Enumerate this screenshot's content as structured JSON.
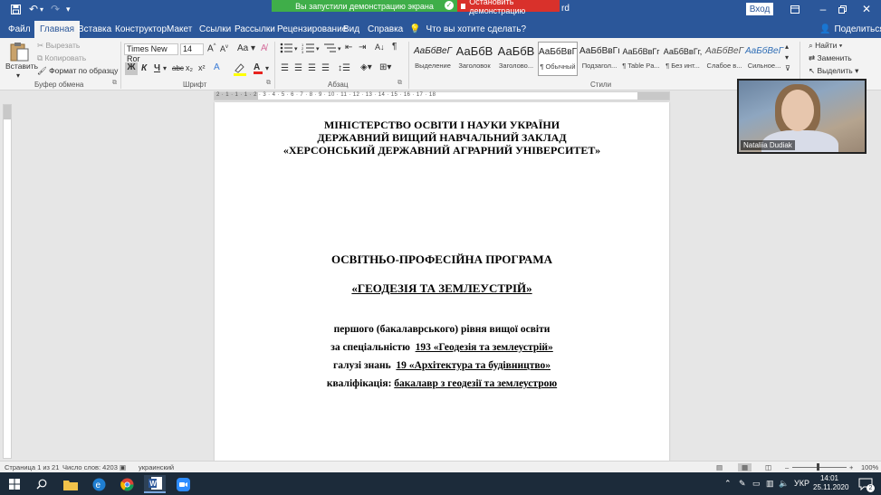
{
  "titlebar": {
    "save_icon": "save-icon",
    "undo_icon": "undo-icon",
    "redo_icon": "redo-icon",
    "customize_icon": "customize-qat-icon",
    "sharing_notice": "Вы запустили демонстрацию экрана",
    "stop_sharing": "Остановить демонстрацию",
    "title_tail": "rd",
    "login": "Вход",
    "ribbon_display_icon": "ribbon-display-icon",
    "minimize_icon": "minimize-icon",
    "restore_icon": "restore-icon",
    "close_icon": "close-icon"
  },
  "tabs": [
    {
      "label": "Файл"
    },
    {
      "label": "Главная",
      "active": true
    },
    {
      "label": "Вставка"
    },
    {
      "label": "Конструктор"
    },
    {
      "label": "Макет"
    },
    {
      "label": "Ссылки"
    },
    {
      "label": "Рассылки"
    },
    {
      "label": "Рецензирование"
    },
    {
      "label": "Вид"
    },
    {
      "label": "Справка"
    }
  ],
  "tell_me": "Что вы хотите сделать?",
  "share": "Поделиться",
  "ribbon": {
    "clipboard": {
      "paste": "Вставить",
      "cut": "Вырезать",
      "copy": "Копировать",
      "format_painter": "Формат по образцу",
      "group": "Буфер обмена"
    },
    "font": {
      "font_name": "Times New Ror",
      "font_size": "14",
      "bold": "Ж",
      "italic": "К",
      "underline": "Ч",
      "strike": "abc",
      "subscript": "x₂",
      "superscript": "x²",
      "grow": "A",
      "shrink": "A",
      "case": "Aa",
      "group": "Шрифт"
    },
    "paragraph": {
      "group": "Абзац",
      "pilcrow": "¶"
    },
    "styles": {
      "group": "Стили",
      "items": [
        {
          "preview": "АаБбВеГ",
          "name": "Выделение"
        },
        {
          "preview": "АаБбВ",
          "name": "Заголовок"
        },
        {
          "preview": "АаБбВ",
          "name": "Заголово..."
        },
        {
          "preview": "АаБбВвГ",
          "name": "¶ Обычный",
          "selected": true
        },
        {
          "preview": "АаБбВвГı",
          "name": "Подзагол..."
        },
        {
          "preview": "АаБбВвГг",
          "name": "¶ Table Pa..."
        },
        {
          "preview": "АаБбВвГг,",
          "name": "¶ Без инт..."
        },
        {
          "preview": "АаБбВеГ",
          "name": "Слабое в..."
        },
        {
          "preview": "АаБбВеГ",
          "name": "Сильное..."
        }
      ]
    },
    "editing": {
      "find": "Найти",
      "replace": "Заменить",
      "select": "Выделить"
    }
  },
  "ruler": {
    "marks": "2 · 1 · 1 · 1 · 2 · 3 · 4 · 5 · 6 · 7 · 8 · 9 · 10 · 11 · 12 · 13 · 14 · 15 · 16 · 17 · 18"
  },
  "document": {
    "line1": "МІНІСТЕРСТВО ОСВІТИ І НАУКИ УКРАЇНИ",
    "line2": "ДЕРЖАВНИЙ ВИЩИЙ НАВЧАЛЬНИЙ ЗАКЛАД",
    "line3": "«ХЕРСОНСЬКИЙ ДЕРЖАВНИЙ АГРАРНИЙ УНІВЕРСИТЕТ»",
    "program_title": "ОСВІТНЬО-ПРОФЕСІЙНА ПРОГРАМА",
    "program_name": "«ГЕОДЕЗІЯ ТА ЗЕМЛЕУСТРІЙ»",
    "level": "першого (бакалаврського) рівня вищої освіти",
    "specialty_label": "за спеціальністю",
    "specialty_value": "193  «Геодезія та землеустрій»",
    "field_label": "галузі знань",
    "field_value": "19 «Архітектура та будівництво»",
    "qualification_label": "кваліфікація:",
    "qualification_value": "бакалавр з геодезії  та землеустрою"
  },
  "webcam": {
    "participant": "Nataliia Dudiak"
  },
  "statusbar": {
    "page": "Страница 1 из 21",
    "words": "Число слов: 4203",
    "language": "украинский",
    "zoom": "100%"
  },
  "taskbar": {
    "start_icon": "windows-start-icon",
    "search_icon": "search-icon",
    "apps": [
      "file-explorer-icon",
      "edge-icon",
      "chrome-icon",
      "word-icon",
      "zoom-icon"
    ],
    "language": "УКР",
    "time": "14:01",
    "date": "25.11.2020",
    "notifications": "2"
  }
}
